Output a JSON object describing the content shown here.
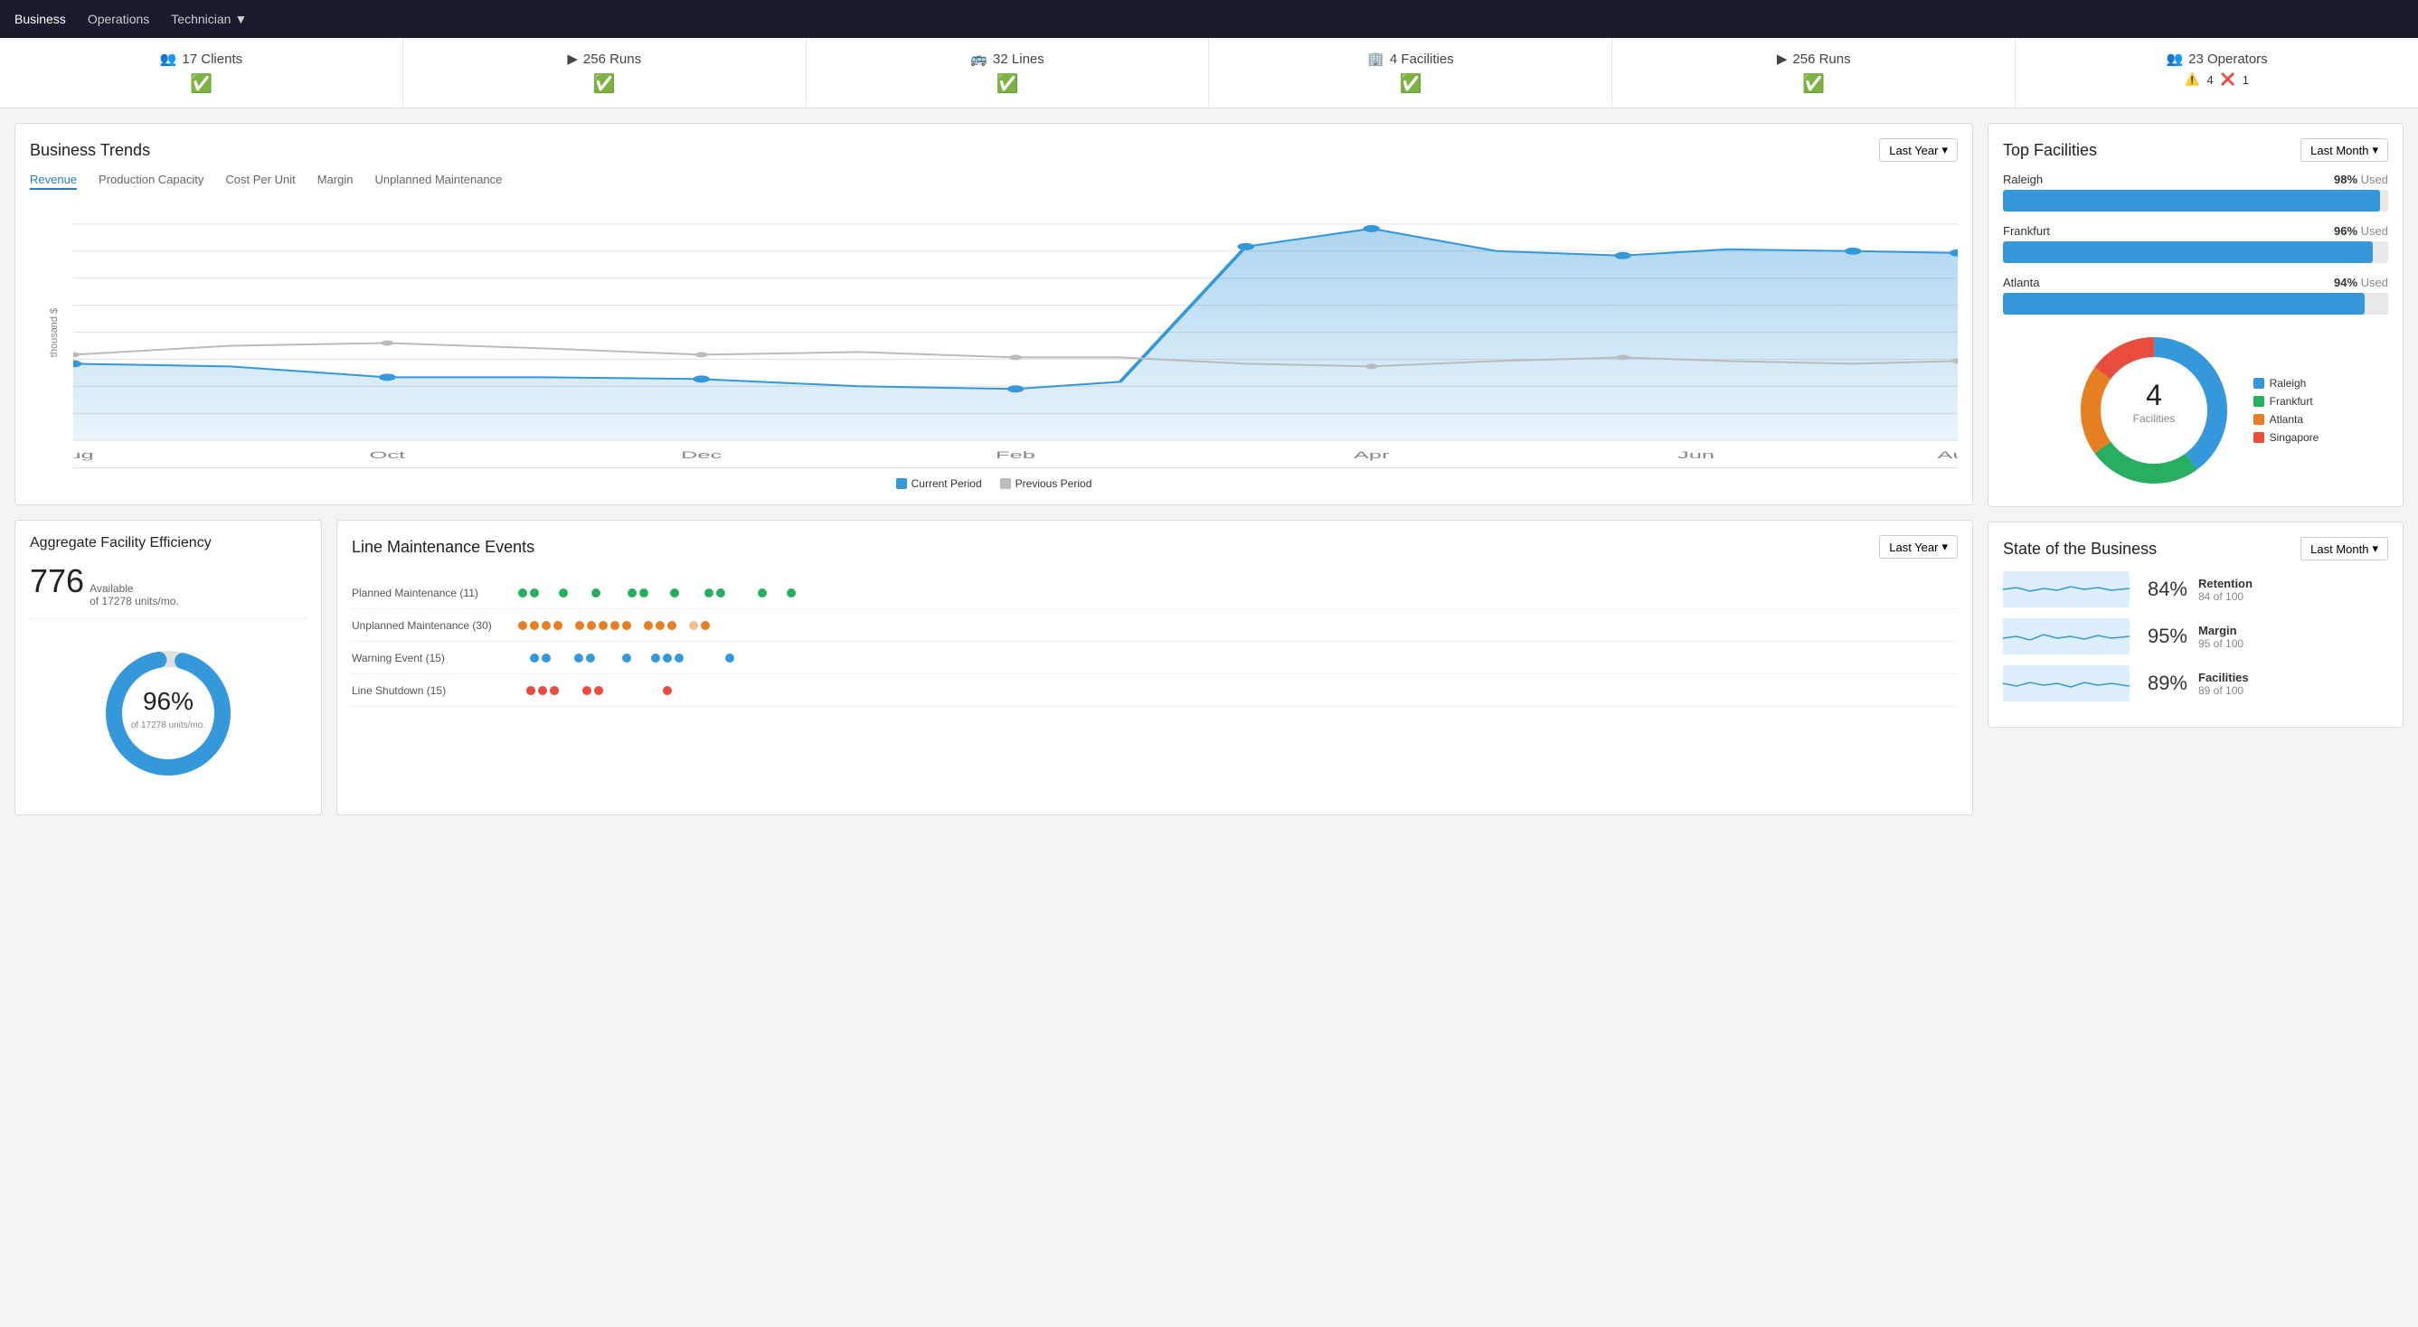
{
  "navbar": {
    "items": [
      {
        "label": "Business",
        "active": true
      },
      {
        "label": "Operations",
        "active": false
      },
      {
        "label": "Technician",
        "active": false,
        "hasDropdown": true
      }
    ]
  },
  "stats": [
    {
      "icon": "👥",
      "count": "17",
      "label": "Clients",
      "status": "ok"
    },
    {
      "icon": "▶",
      "count": "256",
      "label": "Runs",
      "status": "ok"
    },
    {
      "icon": "🚌",
      "count": "32",
      "label": "Lines",
      "status": "ok"
    },
    {
      "icon": "🏢",
      "count": "4",
      "label": "Facilities",
      "status": "ok"
    },
    {
      "icon": "▶",
      "count": "256",
      "label": "Runs",
      "status": "ok"
    },
    {
      "icon": "👥",
      "count": "23",
      "label": "Operators",
      "status": "warn",
      "warnings": 4,
      "errors": 1
    }
  ],
  "businessTrends": {
    "title": "Business Trends",
    "dropdownLabel": "Last Year",
    "tabs": [
      "Revenue",
      "Production Capacity",
      "Cost Per Unit",
      "Margin",
      "Unplanned Maintenance"
    ],
    "activeTab": 0,
    "yLabel": "thousand $",
    "xLabels": [
      "Aug",
      "Oct",
      "Dec",
      "Feb",
      "Apr",
      "Jun",
      "Aug"
    ],
    "legend": [
      {
        "label": "Current Period",
        "color": "#3498db"
      },
      {
        "label": "Previous Period",
        "color": "#bbb"
      }
    ]
  },
  "topFacilities": {
    "title": "Top Facilities",
    "dropdownLabel": "Last Month",
    "facilities": [
      {
        "name": "Raleigh",
        "pct": 98,
        "label": "98% Used"
      },
      {
        "name": "Frankfurt",
        "pct": 96,
        "label": "96% Used"
      },
      {
        "name": "Atlanta",
        "pct": 94,
        "label": "94% Used"
      }
    ],
    "donut": {
      "centerNumber": "4",
      "centerLabel": "Facilities",
      "segments": [
        {
          "label": "Raleigh",
          "color": "#3498db",
          "pct": 40
        },
        {
          "label": "Frankfurt",
          "color": "#27ae60",
          "pct": 25
        },
        {
          "label": "Atlanta",
          "color": "#e67e22",
          "pct": 20
        },
        {
          "label": "Singapore",
          "color": "#e74c3c",
          "pct": 15
        }
      ]
    }
  },
  "aggregateFacility": {
    "title": "Aggregate Facility Efficiency",
    "number": "776",
    "subLabel": "Available",
    "subDetail": "of 17278 units/mo.",
    "pct": "96%",
    "pctDetail": "of 17278 units/mo."
  },
  "lineMaintenance": {
    "title": "Line Maintenance Events",
    "dropdownLabel": "Last Year",
    "rows": [
      {
        "label": "Planned Maintenance (11)",
        "color": "#27ae60",
        "dots": 11
      },
      {
        "label": "Unplanned Maintenance (30)",
        "color": "#e67e22",
        "dots": 15
      },
      {
        "label": "Warning Event (15)",
        "color": "#3498db",
        "dots": 12
      },
      {
        "label": "Line Shutdown (15)",
        "color": "#e74c3c",
        "dots": 8
      }
    ]
  },
  "stateOfBusiness": {
    "title": "State of the Business",
    "dropdownLabel": "Last Month",
    "rows": [
      {
        "pct": "84%",
        "label": "Retention",
        "detail": "84 of 100",
        "color": "#3498db"
      },
      {
        "pct": "95%",
        "label": "Margin",
        "detail": "95 of 100",
        "color": "#3498db"
      },
      {
        "pct": "89%",
        "label": "Facilities",
        "detail": "89 of 100",
        "color": "#3498db"
      }
    ]
  }
}
